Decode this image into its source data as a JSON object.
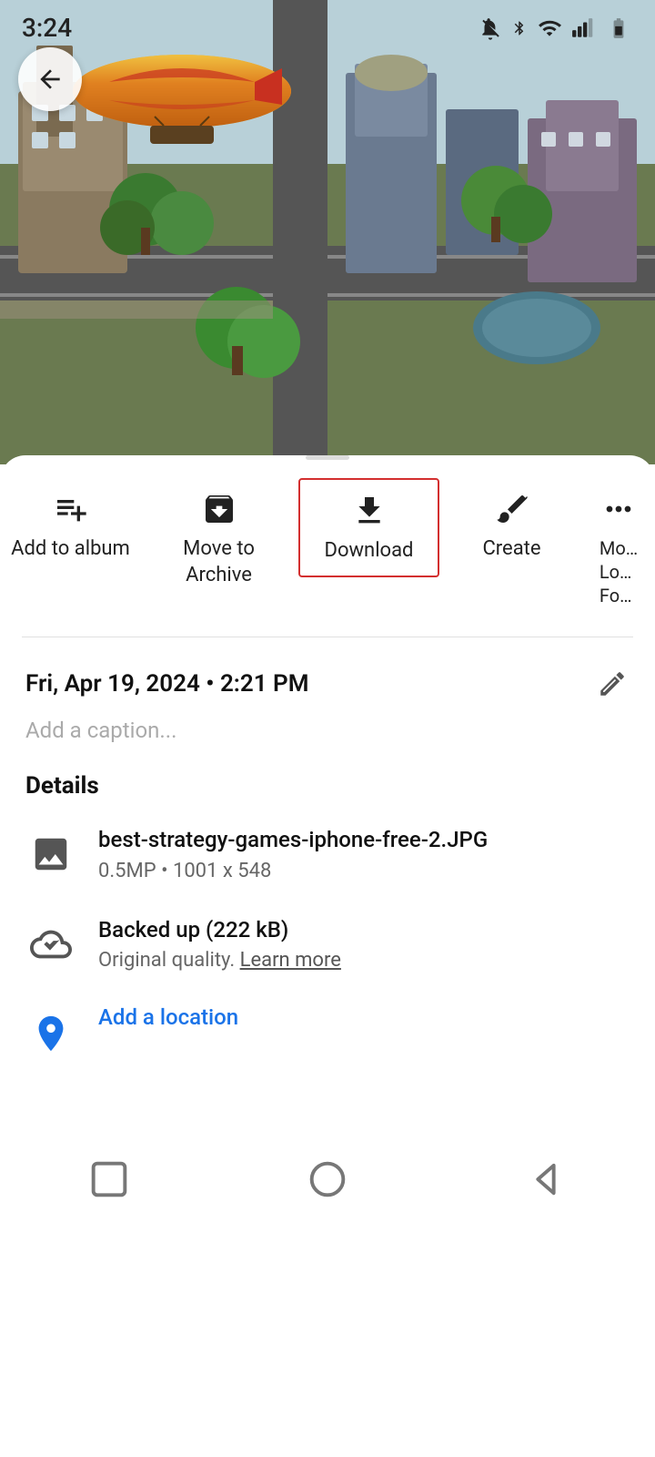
{
  "statusBar": {
    "time": "3:24",
    "icons": [
      "bell-off-icon",
      "bluetooth-icon",
      "wifi-icon",
      "signal-icon",
      "battery-icon"
    ]
  },
  "header": {
    "backLabel": "←"
  },
  "actions": [
    {
      "id": "add-to-album",
      "icon": "playlist-add-icon",
      "label": "Add to\nalbum",
      "highlighted": false
    },
    {
      "id": "move-to-archive",
      "icon": "archive-icon",
      "label": "Move to\nArchive",
      "highlighted": false
    },
    {
      "id": "download",
      "icon": "download-icon",
      "label": "Download",
      "highlighted": true
    },
    {
      "id": "create",
      "icon": "brush-icon",
      "label": "Create",
      "highlighted": false
    },
    {
      "id": "more",
      "icon": "more-icon",
      "label": "Mo…\nLo…\nFo…",
      "highlighted": false
    }
  ],
  "info": {
    "datetime": "Fri, Apr 19, 2024 • 2:21 PM",
    "captionPlaceholder": "Add a caption...",
    "detailsHeading": "Details",
    "filename": "best-strategy-games-iphone-free-2.JPG",
    "filespec": "0.5MP  •  1001 x 548",
    "backupStatus": "Backed up (222 kB)",
    "backupDetail": "Original quality.",
    "learnMoreLabel": "Learn more",
    "locationLabel": "Add a location"
  },
  "navBar": {
    "squareLabel": "□",
    "circleLabel": "○",
    "triangleLabel": "◁"
  }
}
